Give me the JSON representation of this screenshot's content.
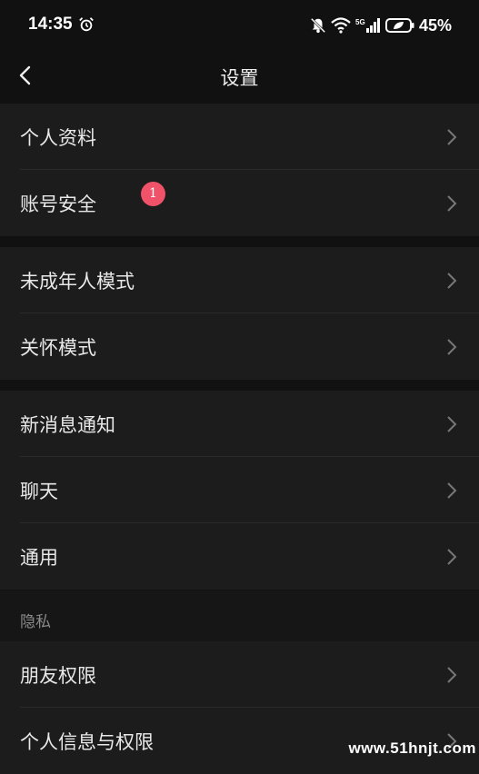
{
  "status_bar": {
    "time": "14:35",
    "battery": "45%",
    "icons": [
      "alarm-icon",
      "mute-bell-icon",
      "wifi-icon",
      "5g-signal-icon",
      "battery-icon"
    ]
  },
  "header": {
    "title": "设置",
    "back_icon": "chevron-left-icon"
  },
  "groups": [
    {
      "items": [
        {
          "label": "个人资料"
        },
        {
          "label": "账号安全",
          "badge": "1"
        }
      ]
    },
    {
      "items": [
        {
          "label": "未成年人模式"
        },
        {
          "label": "关怀模式"
        }
      ]
    },
    {
      "items": [
        {
          "label": "新消息通知"
        },
        {
          "label": "聊天"
        },
        {
          "label": "通用"
        }
      ]
    },
    {
      "section_title": "隐私",
      "items": [
        {
          "label": "朋友权限"
        },
        {
          "label": "个人信息与权限"
        }
      ]
    }
  ],
  "watermark": "www.51hnjt.com",
  "colors": {
    "background": "#111111",
    "row_background": "#1c1c1c",
    "badge": "#f0526a",
    "text": "#e8e8e8",
    "muted_text": "#8a8a8a"
  }
}
